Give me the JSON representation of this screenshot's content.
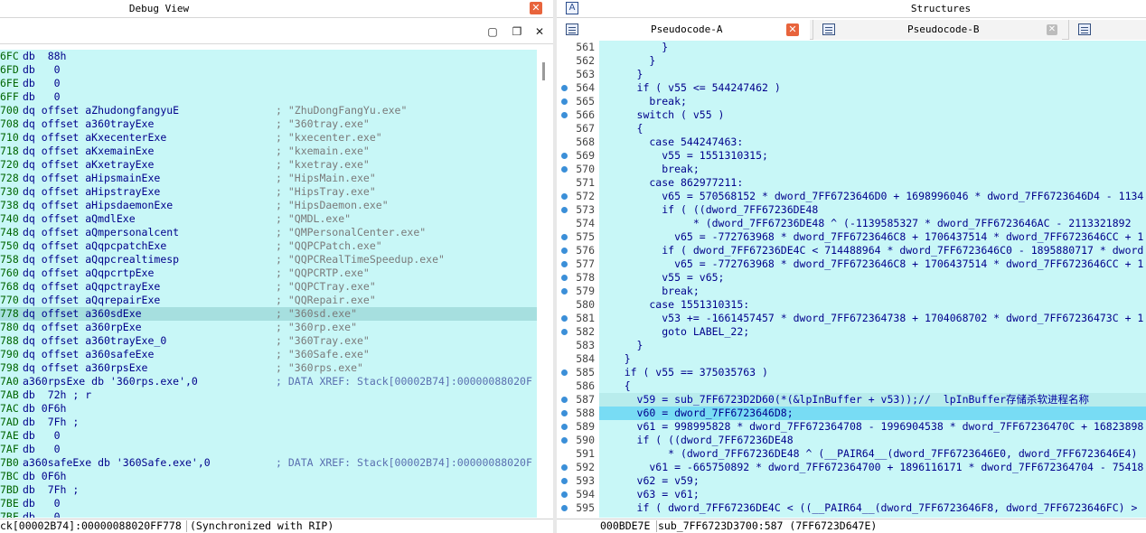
{
  "left_panel": {
    "title": "Debug View",
    "close_glyph": "✕",
    "toolbar": {
      "maximize_glyph": "▢",
      "restore_glyph": "❐",
      "close_glyph": "✕"
    },
    "rows": [
      {
        "addr": "6FC",
        "mn": "db  88h",
        "cmt": ""
      },
      {
        "addr": "6FD",
        "mn": "db   0",
        "cmt": ""
      },
      {
        "addr": "6FE",
        "mn": "db   0",
        "cmt": ""
      },
      {
        "addr": "6FF",
        "mn": "db   0",
        "cmt": ""
      },
      {
        "addr": "700",
        "mn": "dq offset aZhudongfangyuE",
        "cmt": "; \"ZhuDongFangYu.exe\""
      },
      {
        "addr": "708",
        "mn": "dq offset a360trayExe",
        "cmt": "; \"360tray.exe\""
      },
      {
        "addr": "710",
        "mn": "dq offset aKxecenterExe",
        "cmt": "; \"kxecenter.exe\""
      },
      {
        "addr": "718",
        "mn": "dq offset aKxemainExe",
        "cmt": "; \"kxemain.exe\""
      },
      {
        "addr": "720",
        "mn": "dq offset aKxetrayExe",
        "cmt": "; \"kxetray.exe\""
      },
      {
        "addr": "728",
        "mn": "dq offset aHipsmainExe",
        "cmt": "; \"HipsMain.exe\""
      },
      {
        "addr": "730",
        "mn": "dq offset aHipstrayExe",
        "cmt": "; \"HipsTray.exe\""
      },
      {
        "addr": "738",
        "mn": "dq offset aHipsdaemonExe",
        "cmt": "; \"HipsDaemon.exe\""
      },
      {
        "addr": "740",
        "mn": "dq offset aQmdlExe",
        "cmt": "; \"QMDL.exe\""
      },
      {
        "addr": "748",
        "mn": "dq offset aQmpersonalcent",
        "cmt": "; \"QMPersonalCenter.exe\""
      },
      {
        "addr": "750",
        "mn": "dq offset aQqpcpatchExe",
        "cmt": "; \"QQPCPatch.exe\""
      },
      {
        "addr": "758",
        "mn": "dq offset aQqpcrealtimesp",
        "cmt": "; \"QQPCRealTimeSpeedup.exe\""
      },
      {
        "addr": "760",
        "mn": "dq offset aQqpcrtpExe",
        "cmt": "; \"QQPCRTP.exe\""
      },
      {
        "addr": "768",
        "mn": "dq offset aQqpctrayExe",
        "cmt": "; \"QQPCTray.exe\""
      },
      {
        "addr": "770",
        "mn": "dq offset aQqrepairExe",
        "cmt": "; \"QQRepair.exe\""
      },
      {
        "addr": "778",
        "mn": "dq offset a360sdExe",
        "cmt": "; \"360sd.exe\"",
        "highlight": true
      },
      {
        "addr": "780",
        "mn": "dq offset a360rpExe",
        "cmt": "; \"360rp.exe\""
      },
      {
        "addr": "788",
        "mn": "dq offset a360trayExe_0",
        "cmt": "; \"360Tray.exe\""
      },
      {
        "addr": "790",
        "mn": "dq offset a360safeExe",
        "cmt": "; \"360Safe.exe\""
      },
      {
        "addr": "798",
        "mn": "dq offset a360rpsExe",
        "cmt": "; \"360rps.exe\""
      },
      {
        "addr": "7A0",
        "mn": "a360rpsExe db '360rps.exe',0",
        "cmt": "; DATA XREF: Stack[00002B74]:00000088020F",
        "xref": true
      },
      {
        "addr": "7AB",
        "mn": "db  72h ; r",
        "cmt": ""
      },
      {
        "addr": "7AC",
        "mn": "db 0F6h",
        "cmt": ""
      },
      {
        "addr": "7AD",
        "mn": "db  7Fh ;",
        "cmt": ""
      },
      {
        "addr": "7AE",
        "mn": "db   0",
        "cmt": ""
      },
      {
        "addr": "7AF",
        "mn": "db   0",
        "cmt": ""
      },
      {
        "addr": "7B0",
        "mn": "a360safeExe db '360Safe.exe',0",
        "cmt": "; DATA XREF: Stack[00002B74]:00000088020F",
        "xref": true
      },
      {
        "addr": "7BC",
        "mn": "db 0F6h",
        "cmt": ""
      },
      {
        "addr": "7BD",
        "mn": "db  7Fh ;",
        "cmt": ""
      },
      {
        "addr": "7BE",
        "mn": "db   0",
        "cmt": ""
      },
      {
        "addr": "7BF",
        "mn": "db   0",
        "cmt": ""
      }
    ],
    "status_left": "ck[00002B74]:00000088020FF778",
    "status_right": "(Synchronized with RIP)"
  },
  "right_panel": {
    "structures_icon": "A",
    "structures_title": "Structures",
    "tabs": [
      {
        "label": "Pseudocode-A",
        "close": "✕"
      },
      {
        "label": "Pseudocode-B",
        "close": "✕"
      }
    ],
    "lines": [
      {
        "n": "561",
        "dot": false,
        "code": "          }"
      },
      {
        "n": "562",
        "dot": false,
        "code": "        }"
      },
      {
        "n": "563",
        "dot": false,
        "code": "      }"
      },
      {
        "n": "564",
        "dot": true,
        "code": "      if ( v55 <= 544247462 )"
      },
      {
        "n": "565",
        "dot": true,
        "code": "        break;"
      },
      {
        "n": "566",
        "dot": true,
        "code": "      switch ( v55 )"
      },
      {
        "n": "567",
        "dot": false,
        "code": "      {"
      },
      {
        "n": "568",
        "dot": false,
        "code": "        case 544247463:"
      },
      {
        "n": "569",
        "dot": true,
        "code": "          v55 = 1551310315;"
      },
      {
        "n": "570",
        "dot": true,
        "code": "          break;"
      },
      {
        "n": "571",
        "dot": false,
        "code": "        case 862977211:"
      },
      {
        "n": "572",
        "dot": true,
        "code": "          v65 = 570568152 * dword_7FF6723646D0 + 1698996046 * dword_7FF6723646D4 - 1134"
      },
      {
        "n": "573",
        "dot": true,
        "code": "          if ( ((dword_7FF67236DE48"
      },
      {
        "n": "574",
        "dot": false,
        "code": "               * (dword_7FF67236DE48 ^ (-1139585327 * dword_7FF6723646AC - 2113321892 "
      },
      {
        "n": "575",
        "dot": true,
        "code": "            v65 = -772763968 * dword_7FF6723646C8 + 1706437514 * dword_7FF6723646CC + 1"
      },
      {
        "n": "576",
        "dot": true,
        "code": "          if ( dword_7FF67236DE4C < 714488964 * dword_7FF6723646C0 - 1895880717 * dword"
      },
      {
        "n": "577",
        "dot": true,
        "code": "            v65 = -772763968 * dword_7FF6723646C8 + 1706437514 * dword_7FF6723646CC + 1"
      },
      {
        "n": "578",
        "dot": true,
        "code": "          v55 = v65;"
      },
      {
        "n": "579",
        "dot": true,
        "code": "          break;"
      },
      {
        "n": "580",
        "dot": false,
        "code": "        case 1551310315:"
      },
      {
        "n": "581",
        "dot": true,
        "code": "          v53 += -1661457457 * dword_7FF672364738 + 1704068702 * dword_7FF67236473C + 1"
      },
      {
        "n": "582",
        "dot": true,
        "code": "          goto LABEL_22;"
      },
      {
        "n": "583",
        "dot": false,
        "code": "      }"
      },
      {
        "n": "584",
        "dot": false,
        "code": "    }"
      },
      {
        "n": "585",
        "dot": true,
        "code": "    if ( v55 == 375035763 )"
      },
      {
        "n": "586",
        "dot": false,
        "code": "    {"
      },
      {
        "n": "587",
        "dot": true,
        "code": "      v59 = sub_7FF6723D2D60(*(&lpInBuffer + v53));//  lpInBuffer存储杀软进程名称",
        "sel": true
      },
      {
        "n": "588",
        "dot": true,
        "code": "      v60 = dword_7FF6723646D8;",
        "hl": true
      },
      {
        "n": "589",
        "dot": true,
        "code": "      v61 = 998995828 * dword_7FF672364708 - 1996904538 * dword_7FF67236470C + 16823898"
      },
      {
        "n": "590",
        "dot": true,
        "code": "      if ( ((dword_7FF67236DE48"
      },
      {
        "n": "591",
        "dot": false,
        "code": "           * (dword_7FF67236DE48 ^ (__PAIR64__(dword_7FF6723646E0, dword_7FF6723646E4)"
      },
      {
        "n": "592",
        "dot": true,
        "code": "        v61 = -665750892 * dword_7FF672364700 + 1896116171 * dword_7FF672364704 - 75418"
      },
      {
        "n": "593",
        "dot": true,
        "code": "      v62 = v59;"
      },
      {
        "n": "594",
        "dot": true,
        "code": "      v63 = v61;"
      },
      {
        "n": "595",
        "dot": true,
        "code": "      if ( dword_7FF67236DE4C < ((__PAIR64__(dword_7FF6723646F8, dword_7FF6723646FC) >"
      }
    ],
    "status_left": "000BDE7E",
    "status_right": "sub_7FF6723D3700:587 (7FF6723D647E)"
  }
}
